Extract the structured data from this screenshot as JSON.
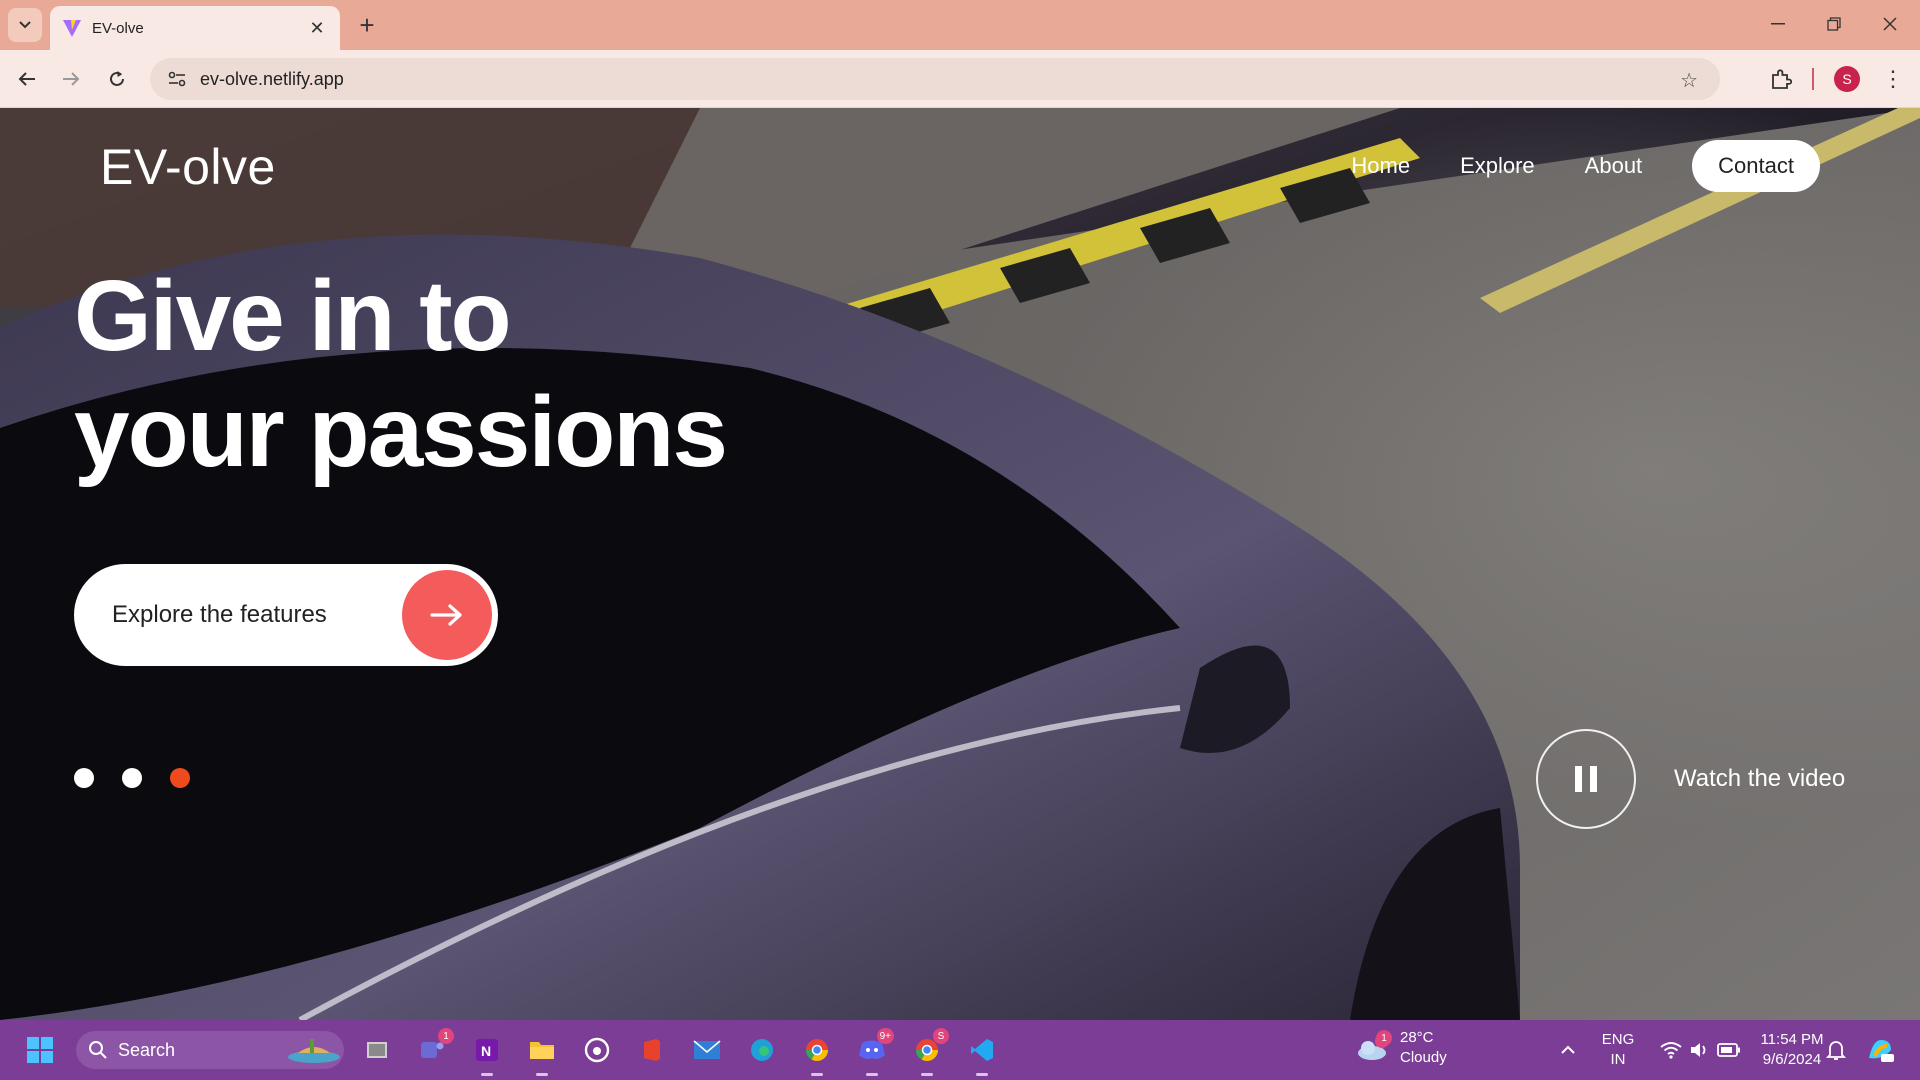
{
  "browser": {
    "tab_title": "EV-olve",
    "url": "ev-olve.netlify.app",
    "profile_initial": "S"
  },
  "page": {
    "logo": "EV-olve",
    "nav": {
      "home": "Home",
      "explore": "Explore",
      "about": "About",
      "contact": "Contact"
    },
    "headline_line1": "Give in to",
    "headline_line2": "your passions",
    "cta_label": "Explore the features",
    "slides": {
      "count": 3,
      "active_index": 2
    },
    "watch_label": "Watch the video",
    "accent_color": "#f45b5b"
  },
  "taskbar": {
    "search_label": "Search",
    "teams_badge": "1",
    "discord_badge": "9+",
    "chrome_badge": "S",
    "weather_badge": "1",
    "temperature": "28°C",
    "condition": "Cloudy",
    "lang": "ENG",
    "region": "IN",
    "time": "11:54 PM",
    "date": "9/6/2024"
  }
}
